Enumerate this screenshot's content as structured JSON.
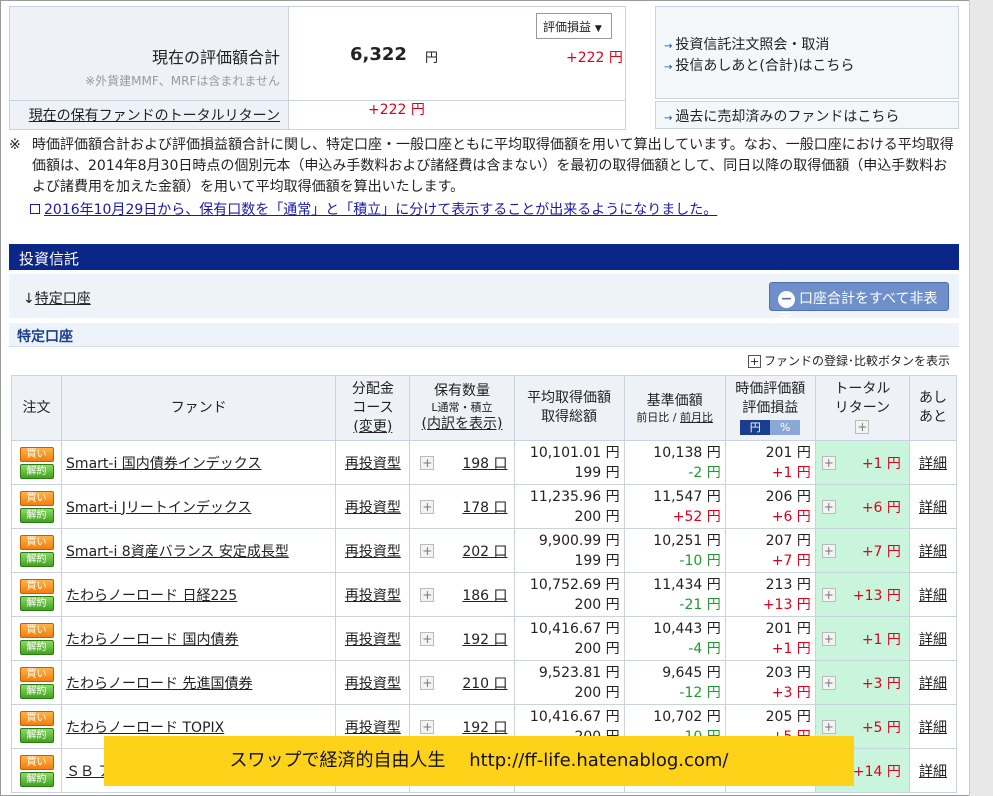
{
  "summary": {
    "total_label": "現在の評価額合計",
    "total_note": "※外貨建MMF、MRFは含まれません",
    "total_value": "6,322",
    "yen": "円",
    "select_label": "評価損益",
    "gain": "+222 円",
    "total_return_label": "現在の保有ファンドのトータルリターン",
    "total_return_value": "+222 円"
  },
  "side_links": [
    "投資信託注文照会・取消",
    "投信あしあと(合計)はこちら",
    "過去に売却済みのファンドはこちら"
  ],
  "note": {
    "mark": "※",
    "text": "時価評価額合計および評価損益額合計に関し、特定口座・一般口座ともに平均取得価額を用いて算出しています。なお、一般口座における平均取得価額は、2014年8月30日時点の個別元本（申込み手数料および諸経費は含まない）を最初の取得価額として、同日以降の取得価額（申込手数料および諸費用を加えた金額）を用いて平均取得価額を算出いたします。",
    "link": "2016年10月29日から、保有口数を「通常」と「積立」に分けて表示することが出来るようになりました。"
  },
  "section_title": "投資信託",
  "account_link_arrow": "↓",
  "account_link": "特定口座",
  "hide_button": "口座合計をすべて非表示",
  "subsection_title": "特定口座",
  "fund_compare_toggle": "ファンドの登録･比較ボタンを表示",
  "table": {
    "headers": {
      "order": "注文",
      "fund": "ファンド",
      "course_1": "分配金",
      "course_2": "コース",
      "course_3": "(変更)",
      "qty_1": "保有数量",
      "qty_2": "L通常・積立",
      "qty_3": "(内訳を表示)",
      "avg_1": "平均取得価額",
      "avg_2": "取得総額",
      "base_1": "基準価額",
      "base_2a": "前日比",
      "base_2sep": " / ",
      "base_2b": "前月比",
      "val_1": "時価評価額",
      "val_2": "評価損益",
      "val_yen": "円",
      "val_pct": "%",
      "tr_1": "トータル",
      "tr_2": "リターン",
      "memo_1": "あし",
      "memo_2": "あと"
    },
    "buy_label": "買い",
    "sell_label": "解約",
    "detail_label": "詳細",
    "rows": [
      {
        "fund": "Smart-i 国内債券インデックス",
        "course": "再投資型",
        "qty": "198 口",
        "avg": "10,101.01 円",
        "cost": "199 円",
        "base": "10,138 円",
        "change": "-2 円",
        "change_color": "green",
        "value": "201 円",
        "pl": "+1 円",
        "tr": "+1 円"
      },
      {
        "fund": "Smart-i Jリートインデックス",
        "course": "再投資型",
        "qty": "178 口",
        "avg": "11,235.96 円",
        "cost": "200 円",
        "base": "11,547 円",
        "change": "+52 円",
        "change_color": "red",
        "value": "206 円",
        "pl": "+6 円",
        "tr": "+6 円"
      },
      {
        "fund": "Smart-i 8資産バランス 安定成長型",
        "course": "再投資型",
        "qty": "202 口",
        "avg": "9,900.99 円",
        "cost": "199 円",
        "base": "10,251 円",
        "change": "-10 円",
        "change_color": "green",
        "value": "207 円",
        "pl": "+7 円",
        "tr": "+7 円"
      },
      {
        "fund": "たわらノーロード 日経225",
        "course": "再投資型",
        "qty": "186 口",
        "avg": "10,752.69 円",
        "cost": "200 円",
        "base": "11,434 円",
        "change": "-21 円",
        "change_color": "green",
        "value": "213 円",
        "pl": "+13 円",
        "tr": "+13 円"
      },
      {
        "fund": "たわらノーロード 国内債券",
        "course": "再投資型",
        "qty": "192 口",
        "avg": "10,416.67 円",
        "cost": "200 円",
        "base": "10,443 円",
        "change": "-4 円",
        "change_color": "green",
        "value": "201 円",
        "pl": "+1 円",
        "tr": "+1 円"
      },
      {
        "fund": "たわらノーロード 先進国債券",
        "course": "再投資型",
        "qty": "210 口",
        "avg": "9,523.81 円",
        "cost": "200 円",
        "base": "9,645 円",
        "change": "-12 円",
        "change_color": "green",
        "value": "203 円",
        "pl": "+3 円",
        "tr": "+3 円"
      },
      {
        "fund": "たわらノーロード TOPIX",
        "course": "再投資型",
        "qty": "192 口",
        "avg": "10,416.67 円",
        "cost": "200 円",
        "base": "10,702 円",
        "change": "-10 円",
        "change_color": "green",
        "value": "205 円",
        "pl": "+5 円",
        "tr": "+5 円"
      },
      {
        "fund": "ＳＢ アンド",
        "course": "",
        "qty": "",
        "avg": "",
        "cost": "",
        "base": "",
        "change": "",
        "change_color": "green",
        "value": "",
        "pl": "",
        "tr": "+14 円"
      }
    ]
  },
  "watermark": "スワップで経済的自由人生　 http://ff-life.hatenablog.com/",
  "colors": {
    "section_bar": "#0a2787",
    "positive": "#e0001b",
    "negative": "#1f9a2f",
    "total_return_bg": "#c9f5dd",
    "watermark_bg": "#ffd21a"
  }
}
